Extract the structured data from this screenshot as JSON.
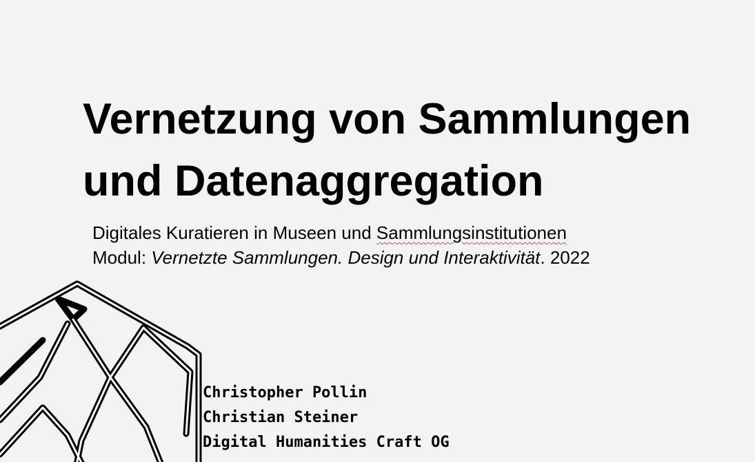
{
  "slide": {
    "title_lines": [
      "Vernetzung von Sammlungen",
      "und Datenaggregation"
    ],
    "subtitle": {
      "line1_prefix": "Digitales Kuratieren in Museen und ",
      "line1_underlined": "Sammlungsinstitutionen",
      "line2_prefix": "Modul: ",
      "line2_italic": "Vernetzte Sammlungen. Design und Interaktivität",
      "line2_suffix": ". 2022"
    },
    "authors": [
      "Christopher Pollin",
      "Christian Steiner",
      "Digital Humanities Craft OG"
    ],
    "logo_icon": "geometric-lattice-logo-icon",
    "colors": {
      "background": "#f3f3f3",
      "text": "#000000",
      "spellcheck_underline": "#d9534f"
    }
  }
}
